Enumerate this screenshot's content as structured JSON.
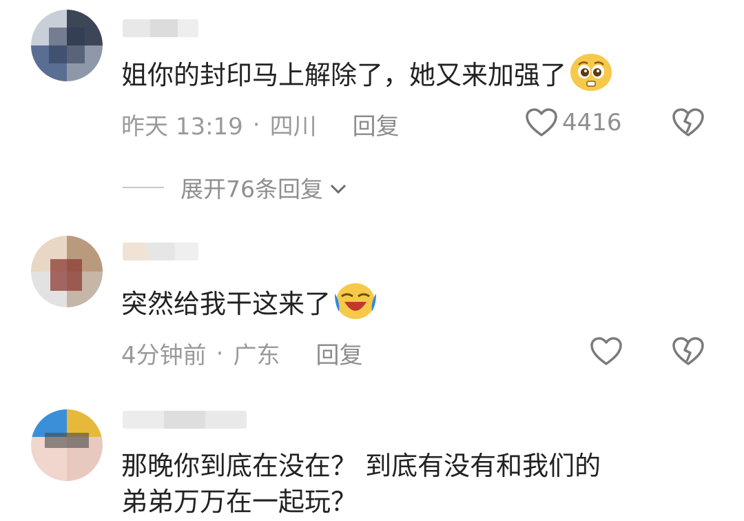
{
  "comments": [
    {
      "text": "姐你的封印马上解除了，她又来加强了",
      "emoji": "pleading-face-emoji",
      "time": "昨天 13:19",
      "location": "四川",
      "reply_label": "回复",
      "like_count": "4416",
      "expand_label": "展开76条回复"
    },
    {
      "text": "突然给我干这来了",
      "emoji": "laughing-crying-emoji",
      "time": "4分钟前",
      "location": "广东",
      "reply_label": "回复",
      "like_count": ""
    },
    {
      "text_line1": "那晚你到底在没在？ 到底有没有和我们的",
      "text_line2": "弟弟万万在一起玩？"
    }
  ],
  "separator": "·",
  "icons": {
    "like": "heart-outline-icon",
    "dislike": "broken-heart-icon",
    "expand": "chevron-down-icon"
  },
  "colors": {
    "text": "#222222",
    "meta": "#9a9a9a",
    "icon": "#7a7a7a"
  }
}
